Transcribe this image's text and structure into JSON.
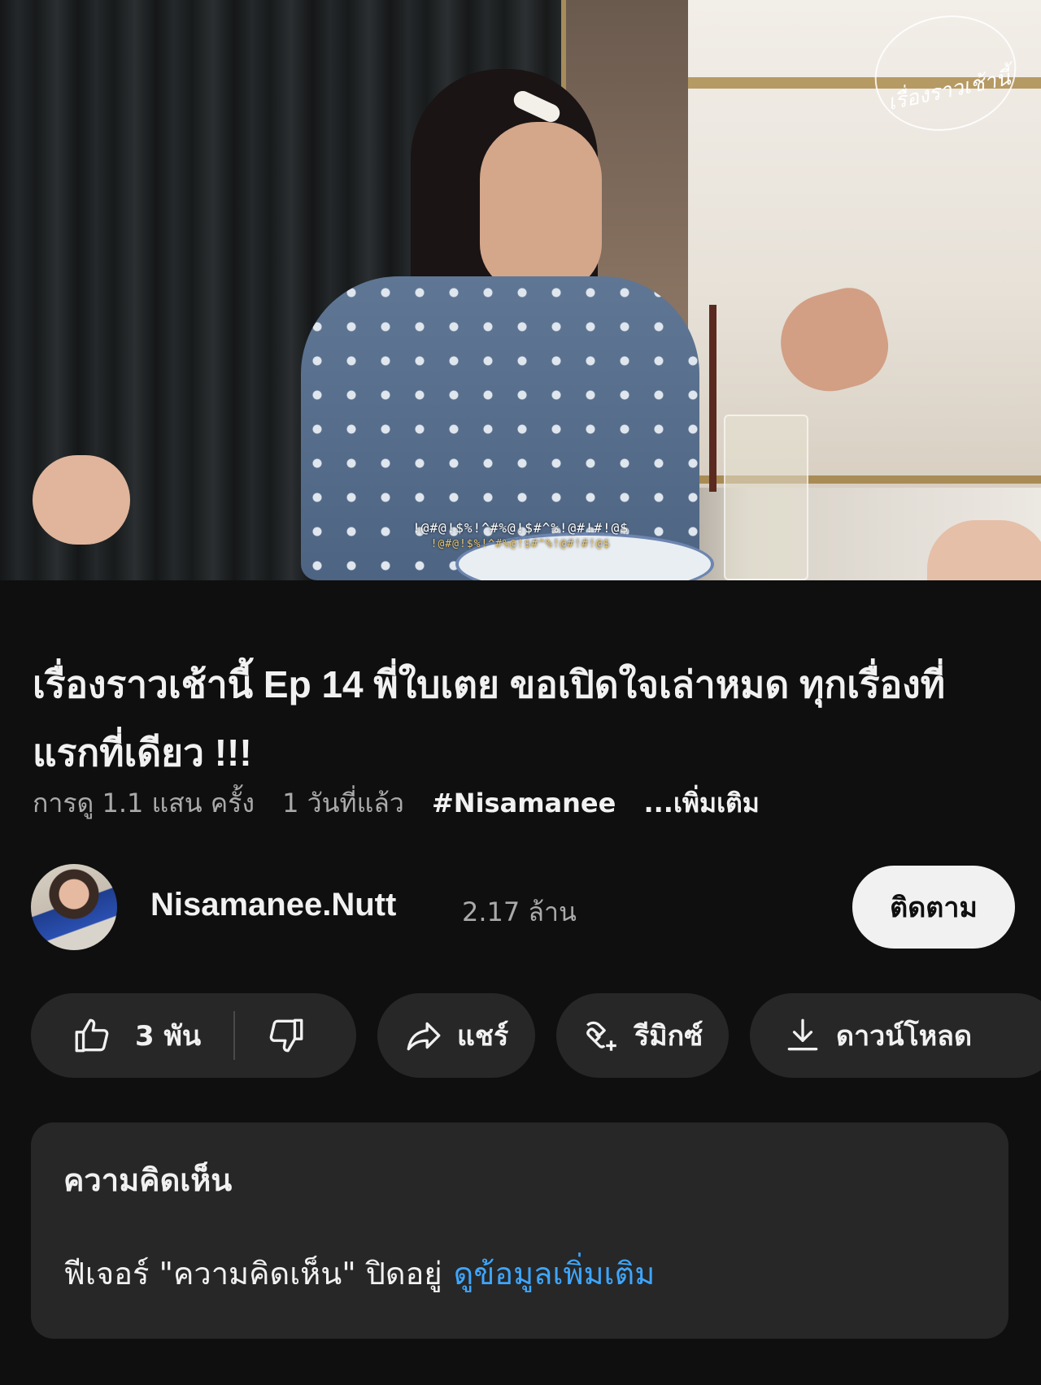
{
  "video": {
    "subtitle_line1": "!@#@!$%!^#%@!$#^%!@#!#!@$",
    "subtitle_line2": "!@#@!$%!^#%@!$#^%!@#!#!@$",
    "watermark_text": "เรื่องราวเช้านี้"
  },
  "details": {
    "title": "เรื่องราวเช้านี้ Ep 14 พี่ใบเตย ขอเปิดใจเล่าหมด ทุกเรื่องที่แรกที่เดียว !!!",
    "views": "การดู 1.1 แสน ครั้ง",
    "age": "1 วันที่แล้ว",
    "hashtag": "#Nisamanee",
    "more": "...เพิ่มเติม"
  },
  "channel": {
    "name": "Nisamanee.Nutt",
    "subscribers": "2.17 ล้าน",
    "subscribe_label": "ติดตาม"
  },
  "actions": {
    "like_count": "3 พัน",
    "share_label": "แชร์",
    "remix_label": "รีมิกซ์",
    "download_label": "ดาวน์โหลด"
  },
  "comments": {
    "title": "ความคิดเห็น",
    "disabled_note": "ฟีเจอร์ \"ความคิดเห็น\" ปิดอยู่",
    "learn_more": "ดูข้อมูลเพิ่มเติม"
  },
  "colors": {
    "background": "#0f0f0f",
    "surface": "#272727",
    "link": "#3ea6ff",
    "subscribe_bg": "#f1f1f1"
  }
}
